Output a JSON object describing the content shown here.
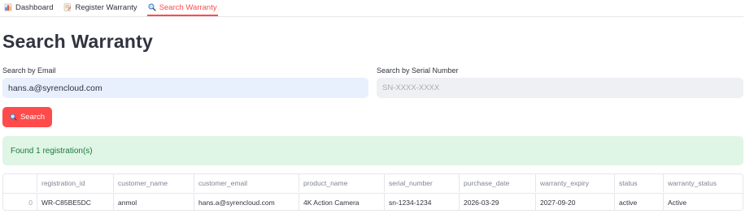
{
  "tabs": [
    {
      "label": "Dashboard",
      "icon": "bar-chart-icon"
    },
    {
      "label": "Register Warranty",
      "icon": "memo-icon"
    },
    {
      "label": "Search Warranty",
      "icon": "magnifier-icon"
    }
  ],
  "page": {
    "title": "Search Warranty"
  },
  "search": {
    "email_label": "Search by Email",
    "email_value": "hans.a@syrencloud.com",
    "serial_label": "Search by Serial Number",
    "serial_placeholder": "SN-XXXX-XXXX",
    "button_label": "Search"
  },
  "result": {
    "message": "Found 1 registration(s)"
  },
  "table": {
    "columns": [
      "",
      "registration_id",
      "customer_name",
      "customer_email",
      "product_name",
      "serial_number",
      "purchase_date",
      "warranty_expiry",
      "status",
      "warranty_status"
    ],
    "rows": [
      [
        "0",
        "WR-C85BE5DC",
        "anmol",
        "hans.a@syrencloud.com",
        "4K Action Camera",
        "sn-1234-1234",
        "2026-03-29",
        "2027-09-20",
        "active",
        "Active"
      ]
    ]
  },
  "colors": {
    "accent": "#ff4b4b",
    "success_bg": "#dff5e6",
    "success_text": "#1d7a3a"
  }
}
